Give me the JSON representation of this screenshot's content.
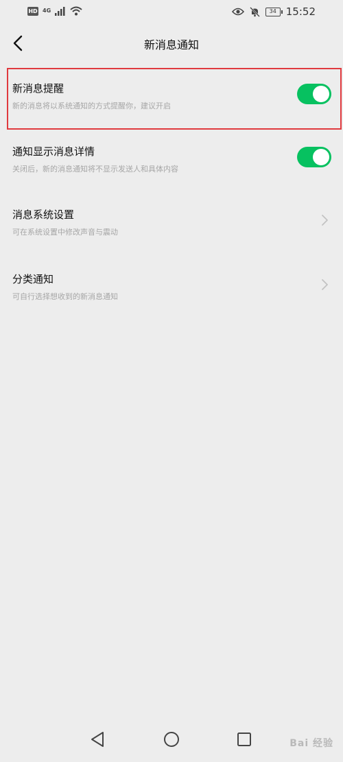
{
  "status_bar": {
    "hd_label": "HD",
    "network_label": "4G",
    "battery_level": "34",
    "time": "15:52"
  },
  "nav": {
    "title": "新消息通知"
  },
  "settings": [
    {
      "title": "新消息提醒",
      "description": "新的消息将以系统通知的方式提醒你，建议开启",
      "control": "toggle",
      "enabled": true
    },
    {
      "title": "通知显示消息详情",
      "description": "关闭后，新的消息通知将不显示发送人和具体内容",
      "control": "toggle",
      "enabled": true
    },
    {
      "title": "消息系统设置",
      "description": "可在系统设置中修改声音与震动",
      "control": "chevron"
    },
    {
      "title": "分类通知",
      "description": "可自行选择想收到的新消息通知",
      "control": "chevron"
    }
  ],
  "colors": {
    "toggle_on": "#07c160",
    "highlight": "#e0393e",
    "background": "#ededed"
  },
  "watermark": {
    "text": "Bai 经验"
  }
}
